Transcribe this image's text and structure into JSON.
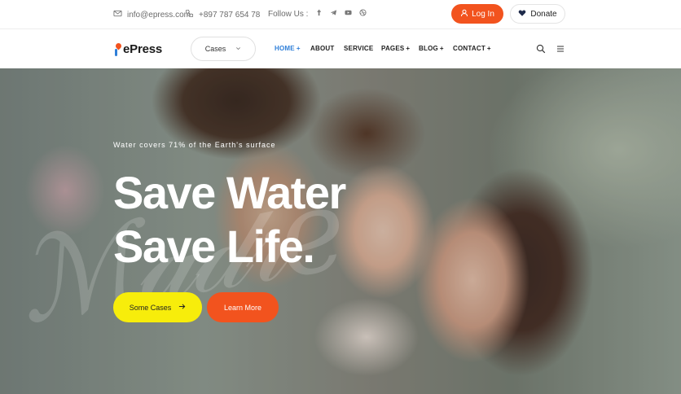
{
  "topbar": {
    "email": "info@epress.com",
    "phone": "+897 787 654 78",
    "follow_label": "Follow Us :",
    "social_icons": [
      "facebook-icon",
      "telegram-icon",
      "youtube-icon",
      "dribbble-icon"
    ],
    "login_label": "Log In",
    "donate_label": "Donate"
  },
  "nav": {
    "logo_text": "ePress",
    "cases_select": {
      "value": "Cases"
    },
    "items": [
      {
        "label": "HOME",
        "has_plus": true,
        "active": true
      },
      {
        "label": "ABOUT",
        "has_plus": false
      },
      {
        "label": "SERVICE",
        "has_plus": false
      },
      {
        "label": "PAGES",
        "has_plus": true
      },
      {
        "label": "BLOG",
        "has_plus": true
      },
      {
        "label": "CONTACT",
        "has_plus": true
      }
    ],
    "icons": [
      "search-icon",
      "menu-icon"
    ]
  },
  "hero": {
    "tagline": "Water covers 71% of the Earth's surface",
    "title_line1": "Save Water",
    "title_line2": "Save Life.",
    "primary_button": "Some Cases",
    "secondary_button": "Learn More"
  },
  "colors": {
    "accent_orange": "#f2531e",
    "accent_yellow": "#f7ed0b",
    "nav_active": "#2f7fd8"
  }
}
